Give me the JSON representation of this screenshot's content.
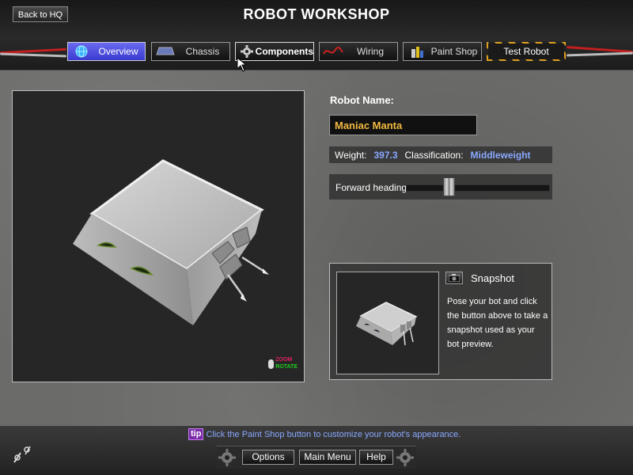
{
  "header": {
    "title": "ROBOT WORKSHOP",
    "back_label": "Back to HQ"
  },
  "tabs": [
    {
      "label": "Overview",
      "icon": "globe-icon"
    },
    {
      "label": "Chassis",
      "icon": "chassis-icon"
    },
    {
      "label": "Components",
      "icon": "gear-icon"
    },
    {
      "label": "Wiring",
      "icon": "wire-icon"
    },
    {
      "label": "Paint Shop",
      "icon": "paint-cans-icon"
    },
    {
      "label": "Test Robot",
      "icon": ""
    }
  ],
  "viewport": {
    "zoom_hint": "ZOOM",
    "rotate_hint": "ROTATE"
  },
  "robot": {
    "name_label": "Robot Name:",
    "name_value": "Maniac Manta",
    "weight_label": "Weight:",
    "weight_value": "397.3",
    "class_label": "Classification:",
    "class_value": "Middleweight",
    "heading_label": "Forward heading:",
    "heading_level": 0.28
  },
  "snapshot": {
    "title": "Snapshot",
    "description": "Pose your bot and click the button above to take a snapshot used as your bot preview."
  },
  "footer": {
    "tip_badge": "tip",
    "tip_text": "Click the Paint Shop button to customize your robot's appearance.",
    "options_label": "Options",
    "main_menu_label": "Main Menu",
    "help_label": "Help"
  },
  "colors": {
    "accent_name": "#f0b840",
    "stat_value": "#8aa8ff",
    "active_tab": "#5050e0",
    "tip_badge": "#7a2aa8"
  }
}
